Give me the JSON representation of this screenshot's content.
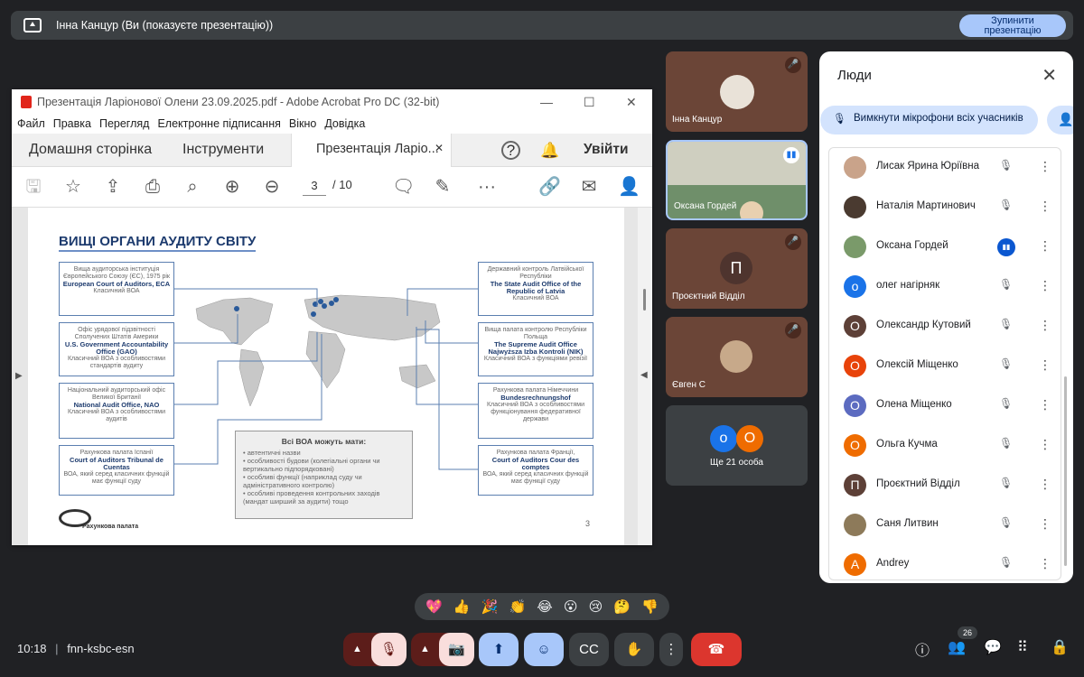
{
  "top_bar": {
    "presenter": "Інна Канцур (Ви (показуєте презентацію))",
    "stop_button_line1": "Зупинити",
    "stop_button_line2": "презентацію"
  },
  "acrobat": {
    "window_title": "Презентація Ларіонової Олени 23.09.2025.pdf - Adobe Acrobat Pro DC (32-bit)",
    "menu": [
      "Файл",
      "Правка",
      "Перегляд",
      "Електронне підписання",
      "Вікно",
      "Довідка"
    ],
    "tab_home": "Домашня сторінка",
    "tab_tools": "Інструменти",
    "tab_doc": "Презентація Ларіо...",
    "sign_in": "Увійти",
    "page_current": "3",
    "page_total": "/ 10",
    "slide": {
      "title": "ВИЩІ ОРГАНИ АУДИТУ СВІТУ",
      "left_boxes": [
        {
          "top": "Вищa аудиторська інституція Європейського Союзу (ЄС), 1975 рік",
          "bold": "European Court of Auditors, ECA",
          "bottom": "Класичний ВОА"
        },
        {
          "top": "Офіс урядової підзвітності Сполучених Штатів Америки",
          "bold": "U.S. Government Accountability Office (GAO)",
          "bottom": "Класичний ВОА з особливостями стандартів аудиту"
        },
        {
          "top": "Національний аудиторський офіс Великої Британії",
          "bold": "National Audit Office, NAO",
          "bottom": "Класичний ВОА з особливостями аудитів"
        },
        {
          "top": "Рахункова палата Іспанії",
          "bold": "Court of Auditors Tribunal de Cuentas",
          "bottom": "ВОА, який серед класичних функцій має функції суду"
        }
      ],
      "right_boxes": [
        {
          "top": "Державний контроль Латвійської Республіки",
          "bold": "The State Audit Office of the Republic of Latvia",
          "bottom": "Класичний ВОА"
        },
        {
          "top": "Вища палата контролю Республіки Польща",
          "bold": "The Supreme Audit Office Najwyższa Izba Kontroli (NIK)",
          "bottom": "Класичний ВОА з функціями ревізії"
        },
        {
          "top": "Рахункова палата Німеччини",
          "bold": "Bundesrechnungshof",
          "bottom": "Класичний ВОА з особливостями функціонування федеративної держави"
        },
        {
          "top": "Рахункова палата Франції,",
          "bold": "Court of Auditors Cour des comptes",
          "bottom": "ВОА, який серед класичних функцій має функції суду"
        }
      ],
      "note_title": "Всі ВОА можуть мати:",
      "note_items": [
        "автентичні назви",
        "особливості будови (колегіальні органи чи вертикально підпорядковані)",
        "особливі функції (наприклад суду чи адміністративного контролю)",
        "особливі проведення контрольних заходів (мандат ширший за аудити) тощо"
      ],
      "logo_text": "Рахункова палата",
      "page_number": "3"
    }
  },
  "tiles": [
    {
      "name": "Інна Канцур"
    },
    {
      "name": "Оксана Гордей"
    },
    {
      "name": "Проєктний Відділ",
      "initial": "П"
    },
    {
      "name": "Євген С"
    },
    {
      "name": "Ще 21 особа",
      "a1": "о",
      "a2": "О"
    }
  ],
  "people_panel": {
    "title": "Люди",
    "mute_all": "Вимкнути мікрофони всіх учасників",
    "participants": [
      {
        "name": "Лисак Ярина Юріївна",
        "initial": "",
        "color": "#c9a38a"
      },
      {
        "name": "Наталія Мартинович",
        "initial": "",
        "color": "#4a3a30"
      },
      {
        "name": "Оксана Гордей",
        "initial": "",
        "color": "#7a9a6a"
      },
      {
        "name": "олег нагірняк",
        "initial": "о",
        "color": "#1a73e8"
      },
      {
        "name": "Олександр Кутовий",
        "initial": "О",
        "color": "#5d4037"
      },
      {
        "name": "Олексій Міщенко",
        "initial": "О",
        "color": "#e8430a"
      },
      {
        "name": "Олена Міщенко",
        "initial": "О",
        "color": "#5c6bc0"
      },
      {
        "name": "Ольга Кучма",
        "initial": "О",
        "color": "#ef6c00"
      },
      {
        "name": "Проєктний Відділ",
        "initial": "П",
        "color": "#5d4037"
      },
      {
        "name": "Саня Литвин",
        "initial": "",
        "color": "#8d7a5a"
      },
      {
        "name": "Andrey",
        "initial": "A",
        "color": "#ef6c00"
      }
    ]
  },
  "reactions": [
    "💖",
    "👍",
    "🎉",
    "👏",
    "😂",
    "😮",
    "😢",
    "🤔",
    "👎"
  ],
  "bottom_bar": {
    "time": "10:18",
    "meeting_code": "fnn-ksbc-esn",
    "participants_count": "26"
  }
}
